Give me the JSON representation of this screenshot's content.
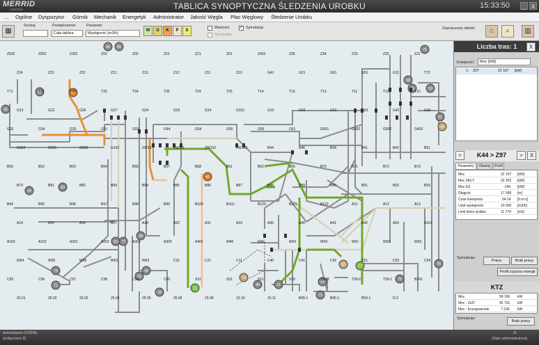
{
  "window": {
    "logo": "MERRID",
    "logo_sub": "CONTROL",
    "title": "TABLICA SYNOPTYCZNA ŚLEDZENIA UROBKU",
    "clock": "15:33:50",
    "minimize": "_",
    "close": "X"
  },
  "menu": {
    "items": [
      "...",
      "Ogólne",
      "Dyspozytor",
      "Górnik",
      "Mechanik",
      "Energetyk",
      "Administrator",
      "Jakość Węgla",
      "Plac Węglowy",
      "Śledzenie Urobku"
    ]
  },
  "toolbar": {
    "search_label": "Szukaj",
    "search_value": "",
    "zoom_label": "Powiększenie",
    "zoom_value": "Cała tablica",
    "param_label": "Parametr",
    "param_value": "Wydajność [m3/h]",
    "filters": [
      {
        "label": "W",
        "color": "#c8e6a8"
      },
      {
        "label": "O",
        "color": "#e6d070"
      },
      {
        "label": "K",
        "color": "#f0a050"
      },
      {
        "label": "P",
        "color": "#e8e8c8"
      },
      {
        "label": "S",
        "color": "#f0ec70"
      }
    ],
    "values_label": "Wartości",
    "sim_label": "Symulacja",
    "details_label": "Szczegóły",
    "selected_label": "Zaznaczony obiekt:"
  },
  "map": {
    "badges": [
      {
        "id": "96",
        "c": "#8a8a8a"
      },
      {
        "id": "89",
        "c": "#8a8a8a"
      },
      {
        "id": "95",
        "c": "#8a8a8a"
      },
      {
        "id": "95",
        "c": "#8a8a8a"
      },
      {
        "id": "93",
        "c": "#e07a20"
      },
      {
        "id": "42",
        "c": "#e07a20"
      },
      {
        "id": "44",
        "c": "#8a8a8a"
      },
      {
        "id": "60",
        "c": "#8a8a8a"
      },
      {
        "id": "77",
        "c": "#8a8a8a"
      },
      {
        "id": "98",
        "c": "#8a8a8a"
      },
      {
        "id": "93",
        "c": "#8a8a8a"
      },
      {
        "id": "44",
        "c": "#8a8a8a"
      },
      {
        "id": "16",
        "c": "#8a8a8a"
      },
      {
        "id": "74",
        "c": "#8a8a8a"
      },
      {
        "id": "71",
        "c": "#8a8a8a"
      },
      {
        "id": "44",
        "c": "#8a8a8a"
      },
      {
        "id": "79",
        "c": "#c8a878"
      },
      {
        "id": "17",
        "c": "#7ac040"
      },
      {
        "id": "46",
        "c": "#8a8a8a"
      },
      {
        "id": "11",
        "c": "#8a8a8a"
      },
      {
        "id": "14",
        "c": "#8a8a8a"
      },
      {
        "id": "72",
        "c": "#8a8a8a"
      },
      {
        "id": "78",
        "c": "#8a8a8a"
      },
      {
        "id": "73",
        "c": "#8a8a8a"
      },
      {
        "id": "59",
        "c": "#8a8a8a"
      },
      {
        "id": "92",
        "c": "#8a8a8a"
      },
      {
        "id": "75",
        "c": "#8a8a8a"
      },
      {
        "id": "49",
        "c": "#c8a878"
      },
      {
        "id": "76",
        "c": "#8a8a8a"
      },
      {
        "id": "98",
        "c": "#8a8a8a"
      },
      {
        "id": "26",
        "c": "#c8a878"
      },
      {
        "id": "15",
        "c": "#7ac040"
      },
      {
        "id": "71",
        "c": "#8a8a8a"
      }
    ],
    "labels": [
      "Z502",
      "Z902",
      "Z302",
      "Z93",
      "Z02",
      "Z01",
      "Z21",
      "Z61",
      "Z401",
      "Z36",
      "Z34",
      "Z33",
      "Z32",
      "Z31",
      "Z24",
      "Z23",
      "Z22",
      "Z21",
      "Z13",
      "Z12",
      "Z11",
      "Z10",
      "G41",
      "G21",
      "G61",
      "G51",
      "G11",
      "T72",
      "T71",
      "T31",
      "T32",
      "T33",
      "T34",
      "T35",
      "T24",
      "T25",
      "T14",
      "T16",
      "T13",
      "T11",
      "T12",
      "T10",
      "G13",
      "G12",
      "G26",
      "G27",
      "G24",
      "G25",
      "G14",
      "G101",
      "G10",
      "G62",
      "G52",
      "G63",
      "G42",
      "G43",
      "G32",
      "G34",
      "G33",
      "G51",
      "G53",
      "G44",
      "G54",
      "G55",
      "G56",
      "G61",
      "G601",
      "G602",
      "G502",
      "G402",
      "G302",
      "G201",
      "G202",
      "G102",
      "ZW13",
      "ZW101",
      "ZW102",
      "ZW103",
      "B44",
      "B46",
      "B34",
      "B41",
      "B42",
      "B51",
      "B50",
      "B52",
      "B53",
      "B54",
      "B55",
      "B57",
      "B58",
      "B61",
      "B62",
      "B65",
      "B70",
      "B71",
      "B72",
      "B73",
      "B74",
      "B81",
      "B82",
      "B83",
      "B84",
      "B85",
      "B86",
      "B87",
      "B88",
      "B89",
      "B90",
      "B91",
      "B92",
      "B93",
      "B94",
      "B95",
      "B96",
      "B97",
      "B98",
      "B99",
      "B100",
      "B101",
      "B120",
      "B121",
      "B122",
      "A11",
      "A12",
      "A13",
      "A14",
      "A15",
      "A16",
      "A17",
      "A18",
      "A22",
      "A31",
      "A33",
      "A36",
      "A40",
      "A41",
      "A42",
      "A53",
      "A101",
      "A102",
      "A103",
      "A201",
      "A202",
      "A301",
      "A302",
      "A401",
      "W40",
      "W41",
      "W42",
      "W43",
      "W51",
      "W52",
      "W53",
      "W54",
      "W55",
      "W56",
      "W62",
      "W63",
      "C31",
      "C21",
      "C11",
      "C40",
      "C41",
      "C42",
      "C51",
      "C53",
      "C54",
      "C55",
      "C56",
      "C57",
      "C58",
      "C59",
      "C60",
      "S31",
      "S21",
      "S11",
      "S10",
      "T29-2",
      "T39-2",
      "T39-1",
      "B241",
      "25.01",
      "25.02",
      "25.03",
      "25.04",
      "25.05",
      "25.06",
      "15.09",
      "15.10",
      "15.11",
      "B95-1",
      "B96-1",
      "B93-1",
      "D-2"
    ]
  },
  "panel": {
    "routes_title": "Liczba tras: 1",
    "order_label": "Kolejność:",
    "order_value": "Moc [kW]",
    "routes": [
      {
        "index": "1",
        "name": "Z97",
        "value": "22 107",
        "unit": "[kW]"
      }
    ],
    "route_title": "K44 > Z97",
    "prev": "<",
    "next": ">",
    "close": "X",
    "tabs": [
      "Parametry",
      "Obiekty",
      "Profil"
    ],
    "params": [
      {
        "name": "Moc",
        "value": "22 107",
        "unit": "[kW]"
      },
      {
        "name": "Moc ZEŁT",
        "value": "22 252",
        "unit": "[kW]"
      },
      {
        "name": "Moc ES",
        "value": "-144",
        "unit": "[kW]"
      },
      {
        "name": "Długość",
        "value": "17 095",
        "unit": "[m]"
      },
      {
        "name": "Czas transportu",
        "value": "54:14",
        "unit": "[h:m:s]"
      },
      {
        "name": "Limit wydajności",
        "value": "10 000",
        "unit": "[m3/h]"
      },
      {
        "name": "Limit ilości urobku",
        "value": "11 774",
        "unit": "[m3]"
      }
    ],
    "sim_label": "Symulacja:",
    "btn_work": "Praca",
    "btn_nowork": "Brak pracy",
    "btn_profile": "Profil zużycia energii",
    "ktz_title": "KTZ",
    "ktz": [
      {
        "name": "Moc",
        "value": "58 196",
        "unit": "kW"
      },
      {
        "name": "Moc - ZełT",
        "value": "42 731",
        "unit": "kW"
      },
      {
        "name": "Moc - Energoserwis",
        "value": "7 239",
        "unit": "kW"
      }
    ],
    "sim_label2": "Symulacja:",
    "btn_nowork2": "Brak pracy"
  },
  "status": {
    "left1": "automatyka (OSDA)",
    "left2": "(połączono 3)",
    "right1": "/5",
    "right2": "(Stan administratora)"
  }
}
